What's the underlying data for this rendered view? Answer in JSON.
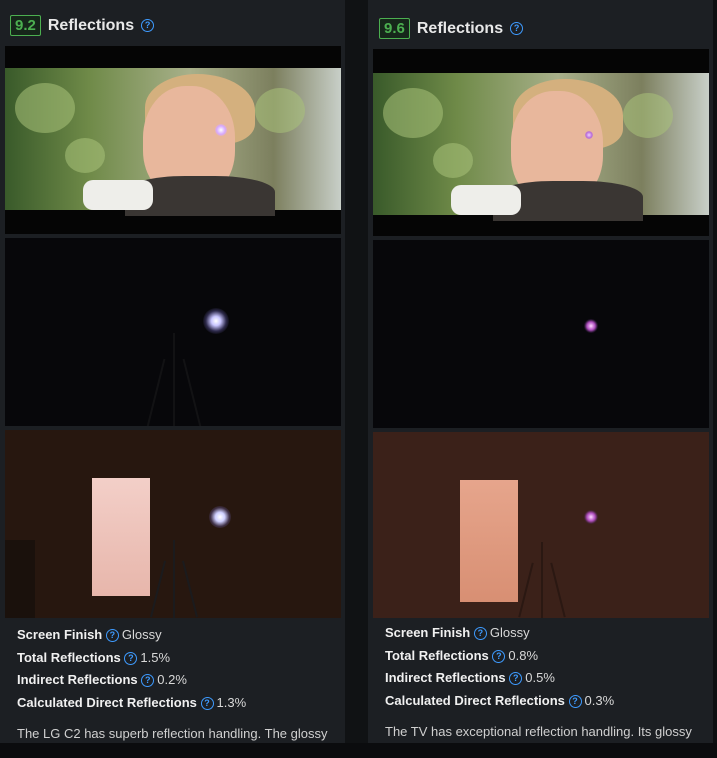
{
  "left": {
    "score": "9.2",
    "title": "Reflections",
    "stats": [
      {
        "label": "Screen Finish",
        "value": "Glossy"
      },
      {
        "label": "Total Reflections",
        "value": "1.5%"
      },
      {
        "label": "Indirect Reflections",
        "value": "0.2%"
      },
      {
        "label": "Calculated Direct Reflections",
        "value": "1.3%"
      }
    ],
    "description": "The LG C2 has superb reflection handling. The glossy"
  },
  "right": {
    "score": "9.6",
    "title": "Reflections",
    "stats": [
      {
        "label": "Screen Finish",
        "value": "Glossy"
      },
      {
        "label": "Total Reflections",
        "value": "0.8%"
      },
      {
        "label": "Indirect Reflections",
        "value": "0.5%"
      },
      {
        "label": "Calculated Direct Reflections",
        "value": "0.3%"
      }
    ],
    "description": "The TV has exceptional reflection handling. Its glossy"
  },
  "icons": {
    "help": "help-circle-icon"
  },
  "colors": {
    "score_green": "#4caf50",
    "help_blue": "#3e9bff"
  }
}
